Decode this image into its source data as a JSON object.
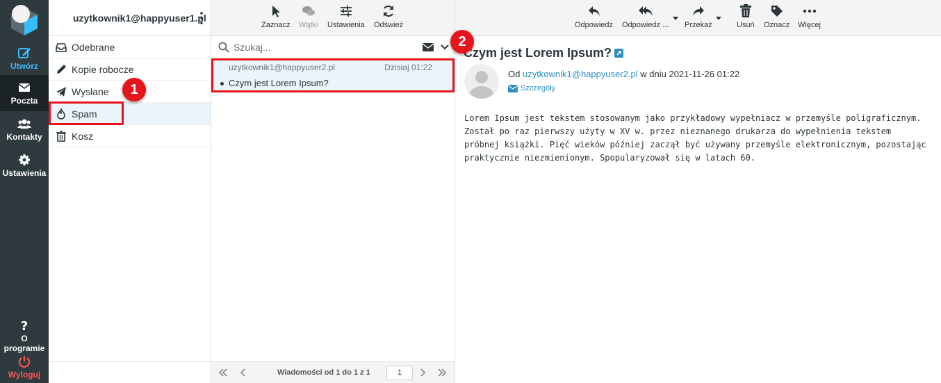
{
  "nav": {
    "compose": "Utwórz",
    "mail": "Poczta",
    "contacts": "Kontakty",
    "settings": "Ustawienia",
    "about": "O programie",
    "logout": "Wyloguj"
  },
  "account": "uzytkownik1@happyuser1.pl",
  "folders": [
    "Odebrane",
    "Kopie robocze",
    "Wysłane",
    "Spam",
    "Kosz"
  ],
  "list_toolbar": {
    "select": "Zaznacz",
    "threads": "Wątki",
    "settings": "Ustawienia",
    "refresh": "Odśwież"
  },
  "search": {
    "placeholder": "Szukaj..."
  },
  "message_item": {
    "from": "uzytkownik1@happyuser2.pl",
    "date": "Dzisiaj 01:22",
    "subject": "Czym jest Lorem Ipsum?"
  },
  "list_footer": {
    "count": "Wiadomości od 1 do 1 z 1",
    "page": "1"
  },
  "view_toolbar": {
    "reply": "Odpowiedz",
    "reply_all": "Odpowiedz ...",
    "forward": "Przekaż",
    "delete": "Usuń",
    "mark": "Oznacz",
    "more": "Więcej"
  },
  "message": {
    "subject": "Czym jest Lorem Ipsum?",
    "from_prefix": "Od",
    "from_addr": "uzytkownik1@happyuser2.pl",
    "date_text": "w dniu 2021-11-26 01:22",
    "details": "Szczegóły",
    "body": "Lorem Ipsum jest tekstem stosowanym jako przykładowy wypełniacz w przemyśle poligraficznym. Został po raz pierwszy użyty w XV w. przez nieznanego drukarza do wypełnienia tekstem próbnej książki. Pięć wieków później zaczął być używany przemyśle elektronicznym, pozostając praktycznie niezmienionym. Spopularyzował się w latach 60."
  },
  "annotations": {
    "badge1": "1",
    "badge2": "2"
  },
  "colors": {
    "accent": "#37beff",
    "highlight": "#e8141c",
    "logout": "#ff5552",
    "link": "#2d8fc2"
  }
}
